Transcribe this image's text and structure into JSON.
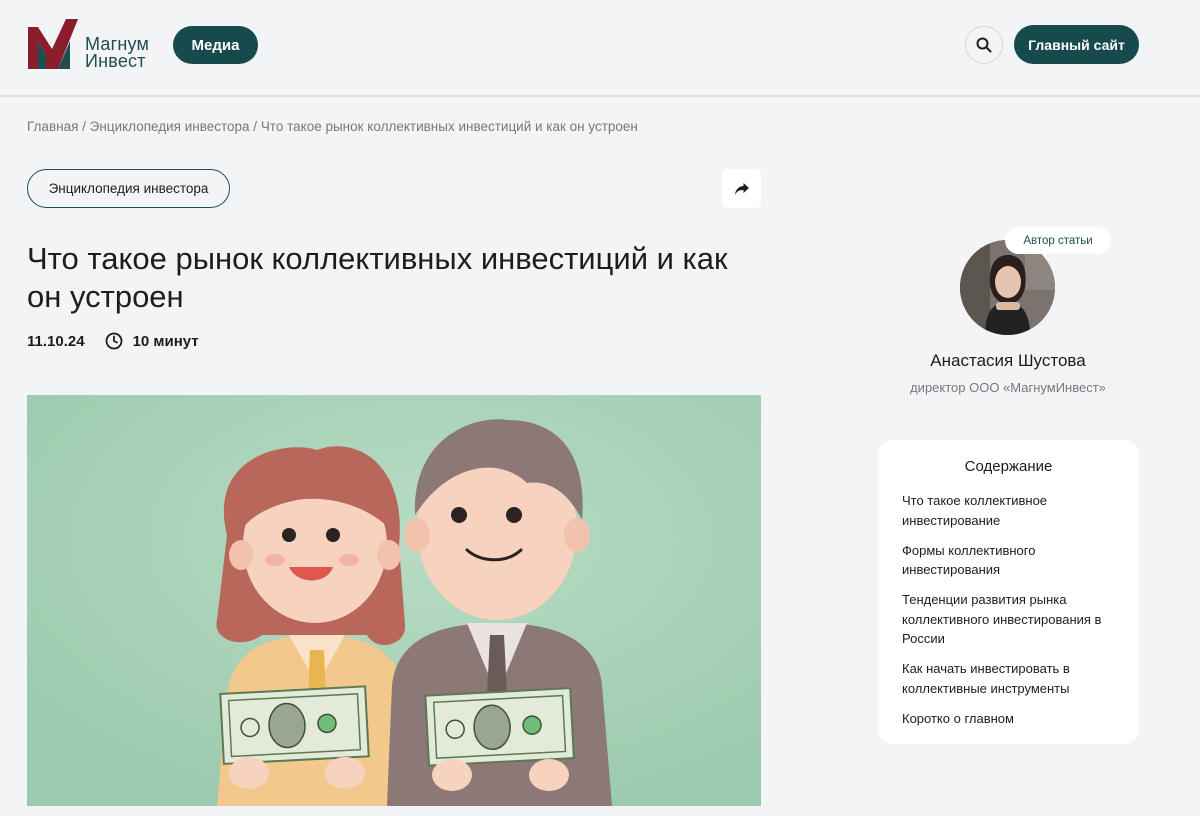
{
  "header": {
    "logo_line1": "Магнум",
    "logo_line2": "Инвест",
    "media_label": "Медиа",
    "main_site_label": "Главный сайт"
  },
  "breadcrumb": [
    "Главная",
    "Энциклопедия инвестора",
    "Что такое рынок коллективных инвестиций и как он устроен"
  ],
  "article": {
    "tag": "Энциклопедия инвестора",
    "title": "Что такое рынок коллективных инвестиций и как он устроен",
    "date": "11.10.24",
    "read_time": "10 минут"
  },
  "author": {
    "badge": "Автор статьи",
    "name": "Анастасия Шустова",
    "role": "директор ООО «МагнумИнвест»"
  },
  "toc": {
    "title": "Содержание",
    "items": [
      "Что такое коллективное инвестирование",
      "Формы коллективного инвестирования",
      "Тенденции развития рынка коллективного инвестирования в России",
      "Как начать инвестировать в коллективные инструменты",
      "Коротко о главном"
    ]
  },
  "icons": {
    "search": "search-icon",
    "share": "share-arrow-icon",
    "clock": "clock-icon"
  },
  "colors": {
    "brand_dark": "#174a4c",
    "logo_red": "#8b1d2c",
    "hero_bg": "#a9d2b8"
  }
}
